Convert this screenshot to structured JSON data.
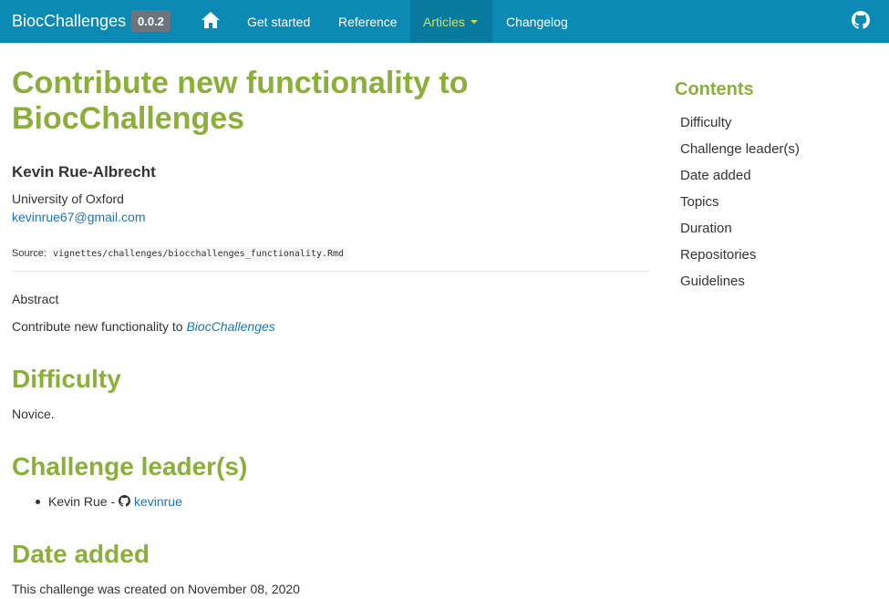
{
  "navbar": {
    "brand": "BiocChallenges",
    "version": "0.0.2",
    "links": [
      "Get started",
      "Reference",
      "Articles",
      "Changelog"
    ]
  },
  "main": {
    "title": "Contribute new functionality to BiocChallenges",
    "author": "Kevin Rue-Albrecht",
    "affiliation": "University of Oxford",
    "email": "kevinrue67@gmail.com",
    "source_label": "Source:",
    "source_path": "vignettes/challenges/biocchallenges_functionality.Rmd",
    "abstract_label": "Abstract",
    "abstract_text": "Contribute new functionality to ",
    "abstract_link": "BiocChallenges",
    "sections": [
      {
        "heading": "Difficulty",
        "text": "Novice."
      },
      {
        "heading": "Challenge leader(s)",
        "leader_name": "Kevin Rue - ",
        "leader_github": "kevinrue"
      },
      {
        "heading": "Date added",
        "text": "This challenge was created on November 08, 2020"
      }
    ]
  },
  "toc": {
    "title": "Contents",
    "items": [
      "Difficulty",
      "Challenge leader(s)",
      "Date added",
      "Topics",
      "Duration",
      "Repositories",
      "Guidelines"
    ]
  },
  "colors": {
    "navbar": "#0b8ab5",
    "heading": "#8ab03a",
    "link": "#1d75b3",
    "active_nav": "#d4e157"
  }
}
